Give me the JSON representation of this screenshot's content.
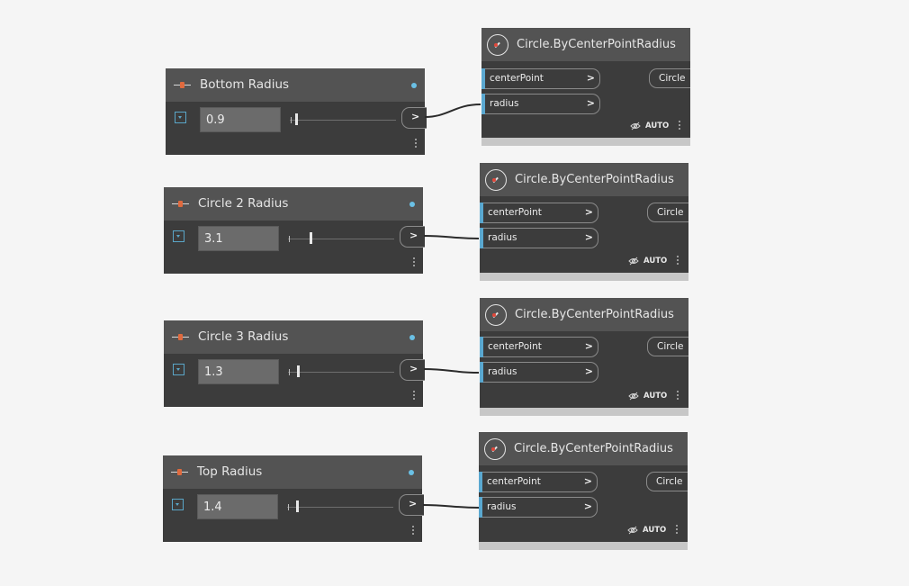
{
  "slider_nodes": [
    {
      "title": "Bottom Radius",
      "value": "0.9",
      "slider_fraction": 0.06
    },
    {
      "title": "Circle 2 Radius",
      "value": "3.1",
      "slider_fraction": 0.21
    },
    {
      "title": "Circle 3 Radius",
      "value": "1.3",
      "slider_fraction": 0.09
    },
    {
      "title": "Top Radius",
      "value": "1.4",
      "slider_fraction": 0.09
    }
  ],
  "circle_nodes": [
    {
      "title": "Circle.ByCenterPointRadius",
      "input_1": "centerPoint",
      "input_2": "radius",
      "output": "Circle",
      "run_mode": "AUTO"
    },
    {
      "title": "Circle.ByCenterPointRadius",
      "input_1": "centerPoint",
      "input_2": "radius",
      "output": "Circle",
      "run_mode": "AUTO"
    },
    {
      "title": "Circle.ByCenterPointRadius",
      "input_1": "centerPoint",
      "input_2": "radius",
      "output": "Circle",
      "run_mode": "AUTO"
    },
    {
      "title": "Circle.ByCenterPointRadius",
      "input_1": "centerPoint",
      "input_2": "radius",
      "output": "Circle",
      "run_mode": "AUTO"
    }
  ],
  "port_chevron": ">",
  "colors": {
    "canvas": "#f5f5f5",
    "node_body": "#3c3c3c",
    "node_header": "#535353",
    "port_accent": "#5aa8d0",
    "state_dot": "#6ac0e5",
    "wire": "#2b2b2b"
  },
  "icons": {
    "slider_node": "slider-icon",
    "circle_node": "circle-node-icon",
    "preview": "eye-slash-icon",
    "menu": "vertical-dots-icon"
  }
}
